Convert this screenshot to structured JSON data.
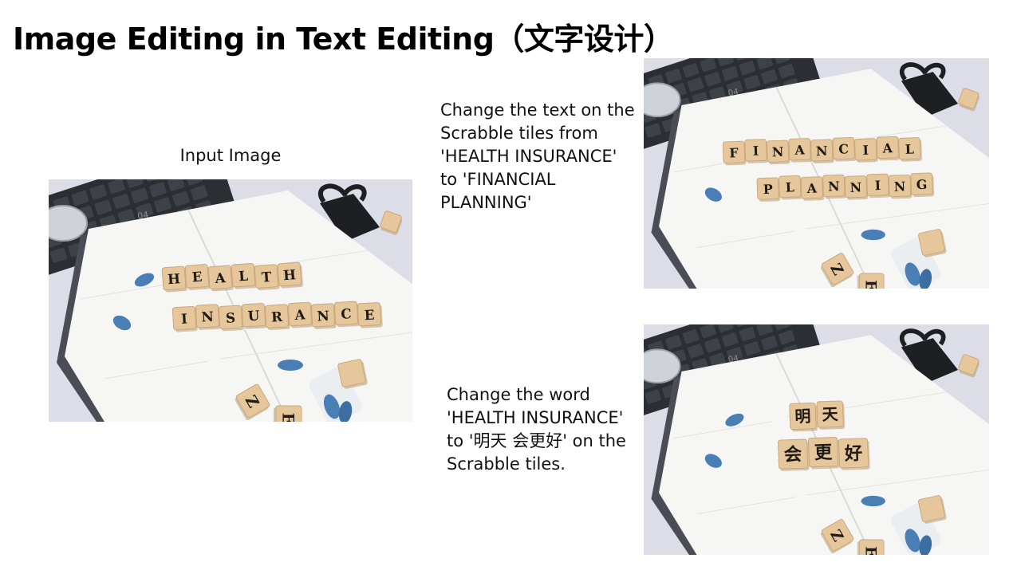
{
  "header": {
    "title": "Image Editing in Text Editing（文字设计）"
  },
  "input": {
    "label": "Input Image",
    "row1": [
      "H",
      "E",
      "A",
      "L",
      "T",
      "H"
    ],
    "row2": [
      "I",
      "N",
      "S",
      "U",
      "R",
      "A",
      "N",
      "C",
      "E"
    ]
  },
  "edits": [
    {
      "prompt": "Change the text on the Scrabble tiles from 'HEALTH INSURANCE' to 'FINANCIAL PLANNING'",
      "row1": [
        "F",
        "I",
        "N",
        "A",
        "N",
        "C",
        "I",
        "A",
        "L"
      ],
      "row2": [
        "P",
        "L",
        "A",
        "N",
        "N",
        "I",
        "N",
        "G"
      ]
    },
    {
      "prompt": "Change the word 'HEALTH INSURANCE' to '明天 会更好' on the Scrabble tiles.",
      "row1": [
        "明",
        "天"
      ],
      "row2": [
        "会",
        "更",
        "好"
      ]
    }
  ],
  "scene": {
    "loose_tiles": [
      "Z",
      "E"
    ],
    "diary_page": "04",
    "colors": {
      "paper": "#f6f6f4",
      "tile": "#e6c79c",
      "pill": "#4a7fb5",
      "keyboard": "#2b2e33",
      "clip": "#1d1f22",
      "background": "#dcdde6"
    }
  }
}
